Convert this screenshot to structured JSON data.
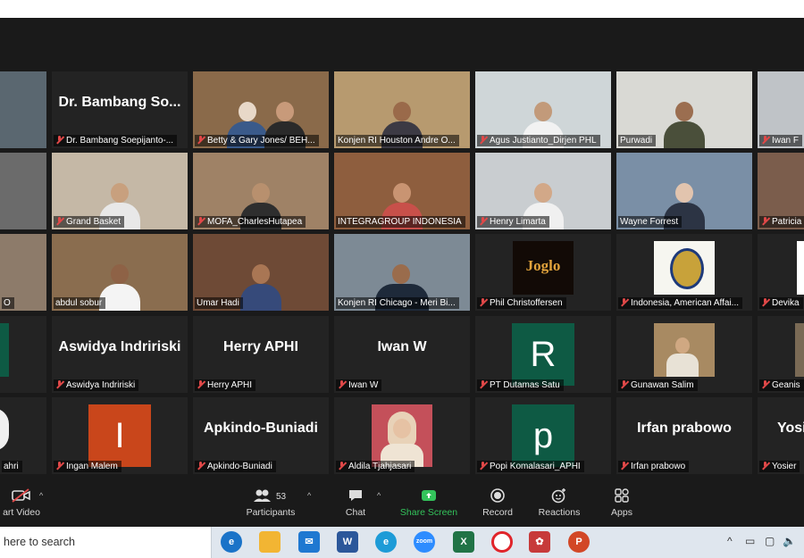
{
  "tiles": [
    {
      "label": "",
      "bg": "#5a6770",
      "name": "",
      "kind": "video"
    },
    {
      "label": "Dr. Bambang Soepijanto-...",
      "bg": "#1f1f1f",
      "name": "Dr. Bambang So...",
      "kind": "name"
    },
    {
      "label": "Betty & Gary Jones/ BEH...",
      "bg": "#8a6a4a",
      "kind": "video"
    },
    {
      "label": "Konjen RI Houston Andre O...",
      "bg": "#b79a6f",
      "kind": "video"
    },
    {
      "label": "Agus Justianto_Dirjen PHL",
      "bg": "#cfd6d8",
      "kind": "video"
    },
    {
      "label": "Purwadi",
      "bg": "#d9d9d4",
      "kind": "video"
    },
    {
      "label": "Iwan F",
      "bg": "#bfc3c7",
      "kind": "video"
    },
    {
      "label": "",
      "bg": "#6b6b6b",
      "kind": "video"
    },
    {
      "label": "Grand Basket",
      "bg": "#c5b8a6",
      "kind": "video"
    },
    {
      "label": "MOFA_CharlesHutapea",
      "bg": "#9f8266",
      "kind": "video"
    },
    {
      "label": "INTEGRAGROUP INDONESIA",
      "bg": "#8e5e3e",
      "kind": "video"
    },
    {
      "label": "Henry Limarta",
      "bg": "#c9cdd0",
      "kind": "video"
    },
    {
      "label": "Wayne Forrest",
      "bg": "#7a8fa6",
      "kind": "video"
    },
    {
      "label": "Patricia",
      "bg": "#7b5d4c",
      "kind": "video"
    },
    {
      "label": "O",
      "bg": "#8d7b6a",
      "kind": "video"
    },
    {
      "label": "abdul sobur",
      "bg": "#8a6d4f",
      "kind": "video"
    },
    {
      "label": "Umar Hadi",
      "bg": "#6e4a36",
      "kind": "video"
    },
    {
      "label": "Konjen RI Chicago - Meri Bi...",
      "bg": "#7d8a95",
      "kind": "video",
      "active": true
    },
    {
      "label": "Phil Christoffersen",
      "bg": "#1f1f1f",
      "kind": "logo",
      "logo": "Joglo"
    },
    {
      "label": "Indonesia, American Affai...",
      "bg": "#1f1f1f",
      "kind": "emblem"
    },
    {
      "label": "Devika",
      "bg": "#1f1f1f",
      "kind": "blank"
    },
    {
      "label": "",
      "bg": "#1f1f1f",
      "kind": "greenbar"
    },
    {
      "label": "Aswidya Indririski",
      "bg": "#1f1f1f",
      "name": "Aswidya Indririski",
      "kind": "name"
    },
    {
      "label": "Herry APHI",
      "bg": "#1f1f1f",
      "name": "Herry APHI",
      "kind": "name"
    },
    {
      "label": "Iwan W",
      "bg": "#1f1f1f",
      "name": "Iwan W",
      "kind": "name"
    },
    {
      "label": "PT Dutamas Satu",
      "bg": "#1f1f1f",
      "kind": "letter",
      "letter": "R",
      "color": "#0e5a44"
    },
    {
      "label": "Gunawan Salim",
      "bg": "#1f1f1f",
      "kind": "photo"
    },
    {
      "label": "Geanis",
      "bg": "#1f1f1f",
      "kind": "blank"
    },
    {
      "label": "ahri",
      "bg": "#1f1f1f",
      "kind": "blank"
    },
    {
      "label": "Ingan Malem",
      "bg": "#1f1f1f",
      "kind": "letter",
      "letter": "I",
      "color": "#c9461b"
    },
    {
      "label": "Apkindo-Buniadi",
      "bg": "#1f1f1f",
      "name": "Apkindo-Buniadi",
      "kind": "name"
    },
    {
      "label": "Aldila Tjahjasari",
      "bg": "#1f1f1f",
      "kind": "portrait"
    },
    {
      "label": "Popi Komalasari_APHI",
      "bg": "#1f1f1f",
      "kind": "letter",
      "letter": "p",
      "color": "#0e5a44"
    },
    {
      "label": "Irfan prabowo",
      "bg": "#1f1f1f",
      "name": "Irfan prabowo",
      "kind": "name"
    },
    {
      "label": "Yosier",
      "bg": "#1f1f1f",
      "name": "Yosi",
      "kind": "name"
    }
  ],
  "toolbar": {
    "start_video": "art Video",
    "participants": "Participants",
    "participants_count": "53",
    "chat": "Chat",
    "share_screen": "Share Screen",
    "record": "Record",
    "reactions": "Reactions",
    "apps": "Apps"
  },
  "taskbar": {
    "search_placeholder": "here to search",
    "apps": [
      "edge-legacy",
      "file-explorer",
      "mail",
      "word",
      "edge",
      "zoom",
      "excel",
      "opera",
      "app-red",
      "powerpoint"
    ]
  }
}
